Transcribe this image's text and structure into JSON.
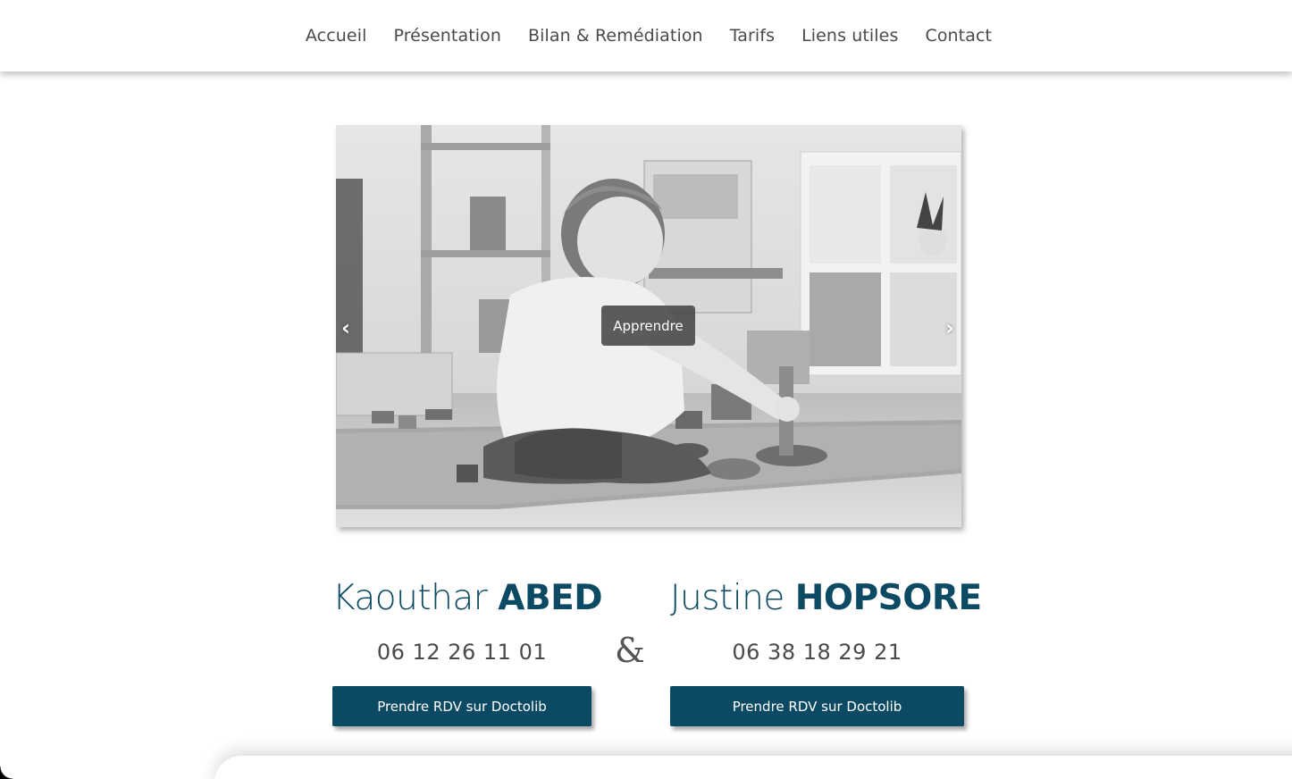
{
  "nav": {
    "items": [
      {
        "label": "Accueil"
      },
      {
        "label": "Présentation"
      },
      {
        "label": "Bilan & Remédiation"
      },
      {
        "label": "Tarifs"
      },
      {
        "label": "Liens utiles"
      },
      {
        "label": "Contact"
      }
    ]
  },
  "slider": {
    "caption": "Apprendre",
    "prev_arrow": "‹",
    "next_arrow": "›",
    "prev_icon": "chevron-left-icon",
    "next_icon": "chevron-right-icon"
  },
  "practitioners": [
    {
      "first_name": "Kaouthar",
      "last_name": "ABED",
      "phone": "06 12 26 11 01",
      "button_label": "Prendre RDV sur Doctolib"
    },
    {
      "first_name": "Justine",
      "last_name": "HOPSORE",
      "phone": "06 38 18 29 21",
      "button_label": "Prendre RDV sur Doctolib"
    }
  ],
  "separator": "&",
  "colors": {
    "brand": "#0c4a63",
    "nav_text": "#4a4a4a",
    "caption_bg": "#464646"
  }
}
